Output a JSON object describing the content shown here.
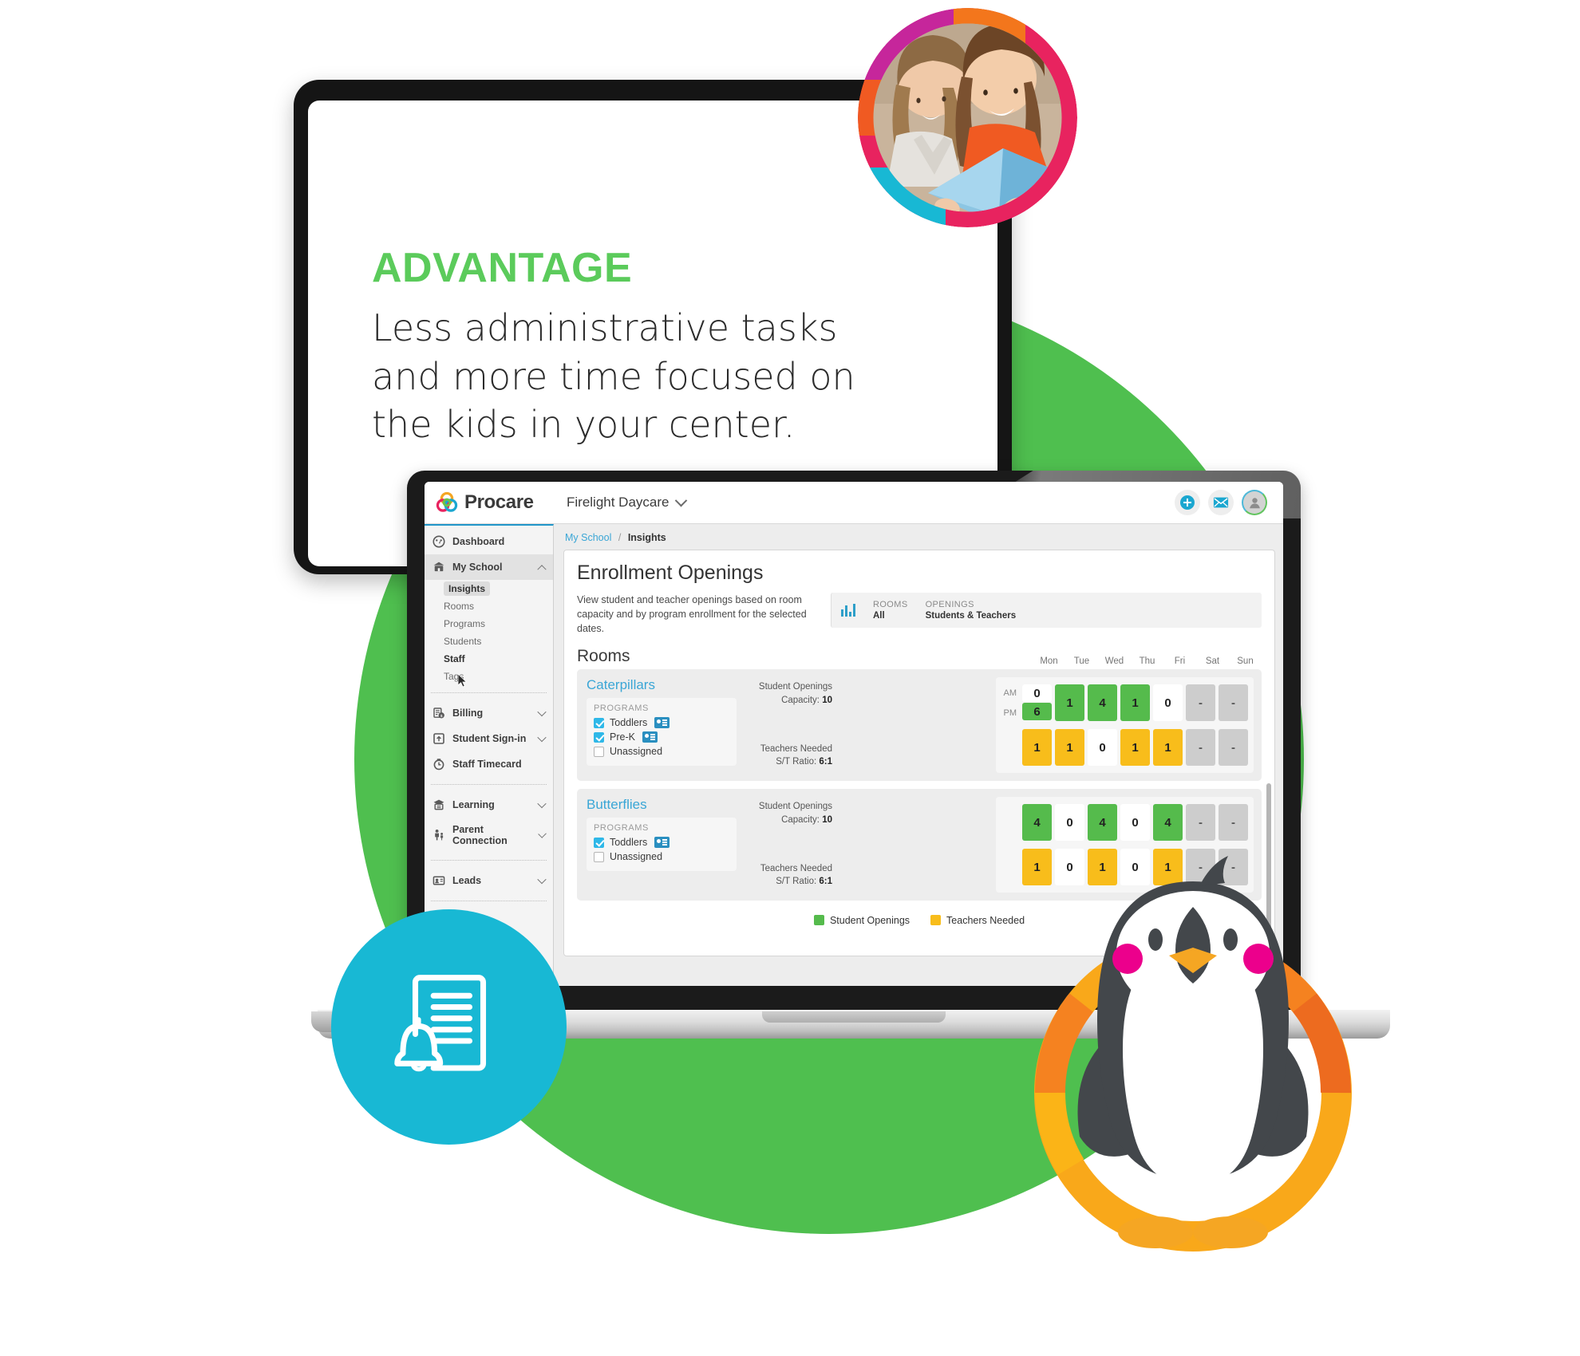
{
  "promo": {
    "kicker": "ADVANTAGE",
    "body": "Less administrative tasks and more time focused on the kids in your center.",
    "kicker_color": "#5BCB5B"
  },
  "app": {
    "brand_name": "Procare",
    "school_selector": "Firelight Daycare",
    "top_actions": [
      {
        "name": "add-icon",
        "label": "+"
      },
      {
        "name": "mail-icon",
        "label": "✉"
      },
      {
        "name": "user-avatar-icon",
        "label": "👤"
      }
    ],
    "breadcrumb": {
      "parent": "My School",
      "separator": "/",
      "current": "Insights"
    },
    "sidebar": [
      {
        "label": "Dashboard",
        "icon": "dashboard-icon",
        "type": "item",
        "caret": "none",
        "active": false
      },
      {
        "label": "My School",
        "icon": "school-icon",
        "type": "item",
        "caret": "up",
        "active": true
      },
      {
        "label": "Insights",
        "type": "sub",
        "selected": true
      },
      {
        "label": "Rooms",
        "type": "sub",
        "selected": false
      },
      {
        "label": "Programs",
        "type": "sub",
        "selected": false
      },
      {
        "label": "Students",
        "type": "sub",
        "selected": false
      },
      {
        "label": "Staff",
        "type": "sub",
        "selected": false,
        "strong": true
      },
      {
        "label": "Tags",
        "type": "sub",
        "selected": false
      },
      {
        "label": "Billing",
        "icon": "billing-icon",
        "type": "item",
        "caret": "down",
        "active": false
      },
      {
        "label": "Student Sign-in",
        "icon": "signin-icon",
        "type": "item",
        "caret": "down",
        "active": false
      },
      {
        "label": "Staff Timecard",
        "icon": "timecard-icon",
        "type": "item",
        "caret": "none",
        "active": false
      },
      {
        "label": "Learning",
        "icon": "learning-icon",
        "type": "item",
        "caret": "down",
        "active": false
      },
      {
        "label": "Parent Connection",
        "icon": "parent-icon",
        "type": "item",
        "caret": "down",
        "active": false
      },
      {
        "label": "Leads",
        "icon": "leads-icon",
        "type": "item",
        "caret": "down",
        "active": false
      }
    ],
    "page": {
      "title": "Enrollment Openings",
      "description": "View student and teacher openings based on room capacity and by program enrollment for the selected dates.",
      "filters": [
        {
          "label": "ROOMS",
          "value": "All"
        },
        {
          "label": "OPENINGS",
          "value": "Students & Teachers"
        }
      ],
      "section_title": "Rooms",
      "legend": [
        {
          "label": "Student Openings",
          "color": "#55bb4c"
        },
        {
          "label": "Teachers Needed",
          "color": "#f8bd1b"
        }
      ]
    }
  },
  "chart_data": {
    "type": "heatmap",
    "title": "Enrollment Openings",
    "xlabel": "",
    "ylabel": "",
    "categories": [
      "Mon",
      "Tue",
      "Wed",
      "Thu",
      "Fri",
      "Sat",
      "Sun"
    ],
    "legend": [
      "Student Openings",
      "Teachers Needed"
    ],
    "rooms": [
      {
        "name": "Caterpillars",
        "programs_header": "PROGRAMS",
        "programs": [
          {
            "label": "Toddlers",
            "checked": true,
            "badge": true
          },
          {
            "label": "Pre-K",
            "checked": true,
            "badge": true
          },
          {
            "label": "Unassigned",
            "checked": false,
            "badge": false
          }
        ],
        "student_openings_label": "Student Openings",
        "capacity_label": "Capacity:",
        "capacity": "10",
        "teachers_needed_label": "Teachers Needed",
        "ratio_label": "S/T Ratio:",
        "ratio": "6:1",
        "student_row": [
          {
            "am": "0",
            "am_state": "w",
            "pm": "6",
            "pm_state": "g",
            "split": true
          },
          {
            "value": "1",
            "state": "g"
          },
          {
            "value": "4",
            "state": "g"
          },
          {
            "value": "1",
            "state": "g"
          },
          {
            "value": "0",
            "state": "w"
          },
          {
            "value": "-",
            "state": "x"
          },
          {
            "value": "-",
            "state": "x"
          }
        ],
        "teacher_row": [
          {
            "value": "1",
            "state": "y"
          },
          {
            "value": "1",
            "state": "y"
          },
          {
            "value": "0",
            "state": "w"
          },
          {
            "value": "1",
            "state": "y"
          },
          {
            "value": "1",
            "state": "y"
          },
          {
            "value": "-",
            "state": "x"
          },
          {
            "value": "-",
            "state": "x"
          }
        ]
      },
      {
        "name": "Butterflies",
        "programs_header": "PROGRAMS",
        "programs": [
          {
            "label": "Toddlers",
            "checked": true,
            "badge": true
          },
          {
            "label": "Unassigned",
            "checked": false,
            "badge": false
          }
        ],
        "student_openings_label": "Student Openings",
        "capacity_label": "Capacity:",
        "capacity": "10",
        "teachers_needed_label": "Teachers Needed",
        "ratio_label": "S/T Ratio:",
        "ratio": "6:1",
        "student_row": [
          {
            "value": "4",
            "state": "g"
          },
          {
            "value": "0",
            "state": "w"
          },
          {
            "value": "4",
            "state": "g"
          },
          {
            "value": "0",
            "state": "w"
          },
          {
            "value": "4",
            "state": "g"
          },
          {
            "value": "-",
            "state": "x"
          },
          {
            "value": "-",
            "state": "x"
          }
        ],
        "teacher_row": [
          {
            "value": "1",
            "state": "y"
          },
          {
            "value": "0",
            "state": "w"
          },
          {
            "value": "1",
            "state": "y"
          },
          {
            "value": "0",
            "state": "w"
          },
          {
            "value": "1",
            "state": "y"
          },
          {
            "value": "-",
            "state": "x"
          },
          {
            "value": "-",
            "state": "x"
          }
        ]
      }
    ]
  },
  "decor": {
    "photo_bubble": "photo-two-women-reading",
    "doc_bell_bubble": "document-bell-icon",
    "penguin": "penguin-mascot"
  }
}
